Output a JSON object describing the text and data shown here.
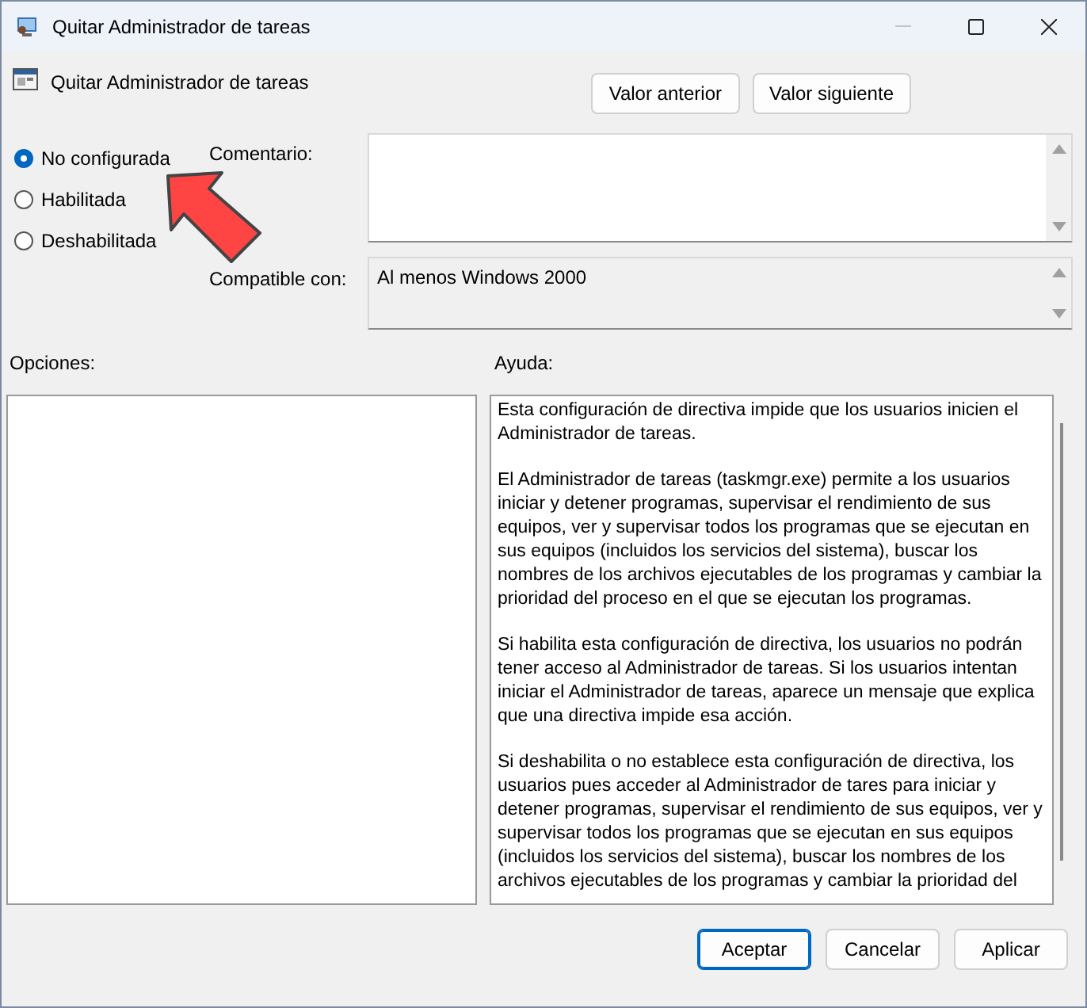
{
  "window": {
    "title": "Quitar Administrador de tareas",
    "controls": [
      {
        "kind": "minimize",
        "disabled": true
      },
      {
        "kind": "maximize",
        "disabled": false
      },
      {
        "kind": "close",
        "disabled": false
      }
    ]
  },
  "header": {
    "setting_name": "Quitar Administrador de tareas",
    "buttons": [
      "Valor anterior",
      "Valor siguiente"
    ]
  },
  "state_options": [
    {
      "label": "No configurada",
      "selected": true
    },
    {
      "label": "Habilitada",
      "selected": false
    },
    {
      "label": "Deshabilitada",
      "selected": false
    }
  ],
  "comment": {
    "label": "Comentario:"
  },
  "compatible": {
    "label": "Compatible con:",
    "value": "Al menos Windows 2000"
  },
  "options": {
    "label": "Opciones:"
  },
  "help": {
    "label": "Ayuda:",
    "paragraphs": [
      "Esta configuración de directiva impide que los usuarios inicien el Administrador de tareas.",
      "El Administrador de tareas (taskmgr.exe) permite a los usuarios iniciar y detener programas, supervisar el rendimiento de sus equipos, ver y supervisar todos los programas que se ejecutan en sus equipos (incluidos los servicios del sistema), buscar los nombres de los archivos ejecutables de los programas y cambiar la prioridad del proceso en el que se ejecutan los programas.",
      "Si habilita esta configuración de directiva, los usuarios no podrán tener acceso al Administrador de tareas. Si los usuarios intentan iniciar el Administrador de tareas, aparece un mensaje que explica que una directiva impide esa acción.",
      "Si deshabilita o no establece esta configuración de directiva, los usuarios pues acceder al Administrador de tares para iniciar y detener programas, supervisar el rendimiento de sus equipos, ver y supervisar todos los programas que se ejecutan en sus equipos (incluidos los servicios del sistema), buscar los nombres de los archivos ejecutables de los programas y cambiar la prioridad del"
    ]
  },
  "footer_buttons": [
    {
      "label": "Aceptar",
      "kind": "default"
    },
    {
      "label": "Cancelar",
      "kind": "normal"
    },
    {
      "label": "Aplicar",
      "kind": "normal"
    }
  ]
}
